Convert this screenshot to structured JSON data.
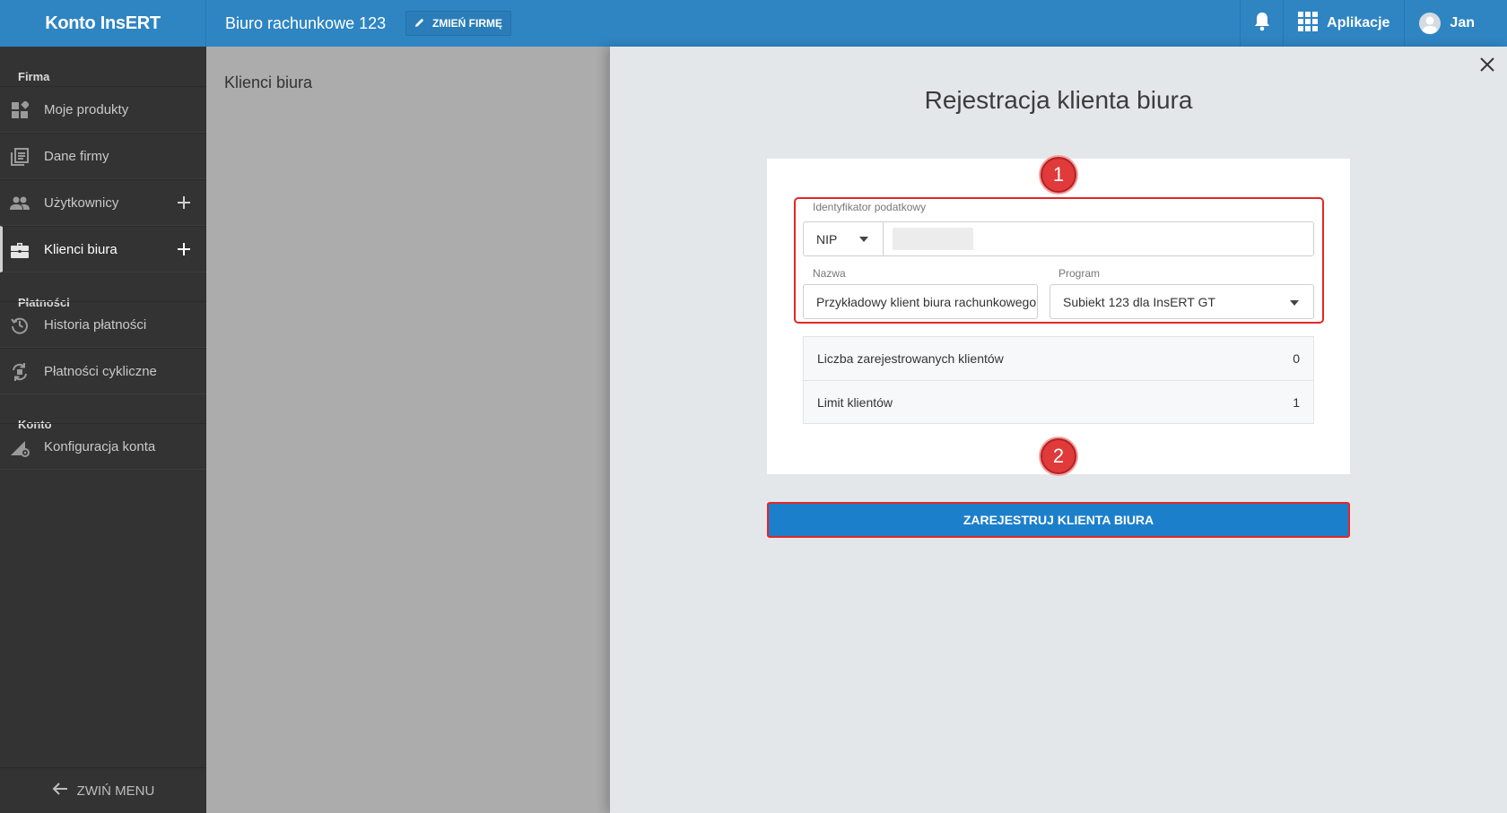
{
  "topbar": {
    "brand": "Konto InsERT",
    "company_name": "Biuro rachunkowe 123",
    "change_company_label": "ZMIEŃ FIRMĘ",
    "apps_label": "Aplikacje",
    "user_name": "Jan",
    "bell_icon": "bell-icon",
    "apps_icon": "grid-icon"
  },
  "sidebar": {
    "sections": [
      {
        "title": "Firma"
      },
      {
        "title": "Płatności"
      },
      {
        "title": "Konto"
      }
    ],
    "items": [
      {
        "label": "Moje produkty",
        "icon": "products-icon"
      },
      {
        "label": "Dane firmy",
        "icon": "document-icon"
      },
      {
        "label": "Użytkownicy",
        "icon": "users-icon"
      },
      {
        "label": "Klienci biura",
        "icon": "briefcase-icon"
      },
      {
        "label": "Historia płatności",
        "icon": "history-icon"
      },
      {
        "label": "Płatności cykliczne",
        "icon": "recurring-icon"
      },
      {
        "label": "Konfiguracja konta",
        "icon": "config-icon"
      }
    ],
    "active_item": "Klienci biura",
    "collapse_label": "ZWIŃ MENU"
  },
  "content": {
    "title": "Klienci biura"
  },
  "panel": {
    "title": "Rejestracja klienta biura",
    "tax_id_label": "Identyfikator podatkowy",
    "tax_id_type": "NIP",
    "name_label": "Nazwa",
    "name_value": "Przykładowy klient biura rachunkowego",
    "program_label": "Program",
    "program_value": "Subiekt 123 dla InsERT GT",
    "stats": [
      {
        "label": "Liczba zarejestrowanych klientów",
        "value": "0"
      },
      {
        "label": "Limit klientów",
        "value": "1"
      }
    ],
    "register_button": "ZAREJESTRUJ KLIENTA BIURA",
    "badges": [
      "1",
      "2"
    ]
  },
  "colors": {
    "topbar": "#2e85c2",
    "sidebar": "#333333",
    "primary_button": "#1c7fcb",
    "highlight": "#e32727"
  }
}
